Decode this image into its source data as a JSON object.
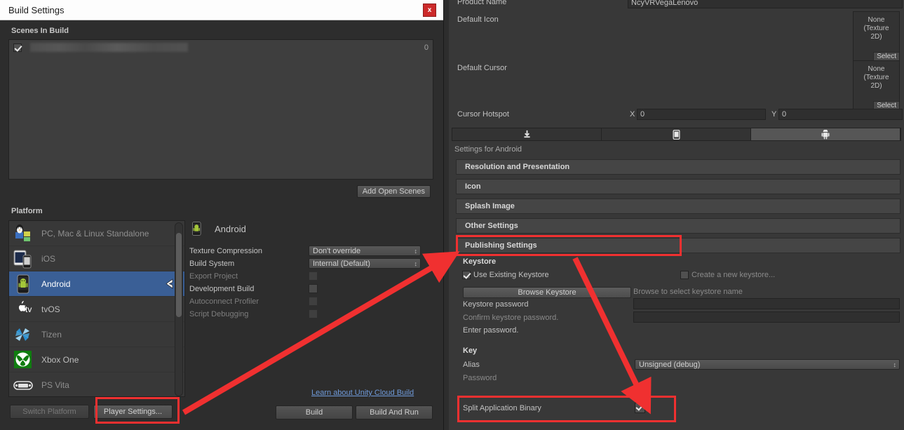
{
  "window": {
    "title": "Build Settings",
    "close_label": "x"
  },
  "scenes": {
    "header": "Scenes In Build",
    "rows": [
      {
        "checked": true,
        "name": "",
        "index": "0"
      }
    ],
    "add_open_scenes_label": "Add Open Scenes"
  },
  "platform": {
    "header": "Platform",
    "items": [
      {
        "label": "PC, Mac & Linux Standalone",
        "icon": "standalone-icon",
        "selected": false,
        "enabled": true
      },
      {
        "label": "iOS",
        "icon": "ios-icon",
        "selected": false,
        "enabled": false
      },
      {
        "label": "Android",
        "icon": "android-icon",
        "selected": true,
        "enabled": true
      },
      {
        "label": "tvOS",
        "icon": "tvos-icon",
        "selected": false,
        "enabled": true
      },
      {
        "label": "Tizen",
        "icon": "tizen-icon",
        "selected": false,
        "enabled": false
      },
      {
        "label": "Xbox One",
        "icon": "xbox-one-icon",
        "selected": false,
        "enabled": true
      },
      {
        "label": "PS Vita",
        "icon": "ps-vita-icon",
        "selected": false,
        "enabled": false
      }
    ],
    "switch_platform_label": "Switch Platform",
    "player_settings_label": "Player Settings..."
  },
  "build_options": {
    "platform_title": "Android",
    "texture_compression": {
      "label": "Texture Compression",
      "value": "Don't override"
    },
    "build_system": {
      "label": "Build System",
      "value": "Internal (Default)"
    },
    "toggles": [
      {
        "label": "Export Project",
        "checked": false,
        "enabled": false
      },
      {
        "label": "Development Build",
        "checked": false,
        "enabled": true
      },
      {
        "label": "Autoconnect Profiler",
        "checked": false,
        "enabled": false
      },
      {
        "label": "Script Debugging",
        "checked": false,
        "enabled": false
      }
    ],
    "cloud_build_link": "Learn about Unity Cloud Build",
    "build_label": "Build",
    "build_and_run_label": "Build And Run"
  },
  "inspector": {
    "product_name": {
      "label": "Product Name",
      "value": "NcyVRVegaLenovo"
    },
    "default_icon": {
      "label": "Default Icon",
      "value": "None\n(Texture 2D)",
      "select_label": "Select"
    },
    "default_cursor": {
      "label": "Default Cursor",
      "value": "None\n(Texture 2D)",
      "select_label": "Select"
    },
    "cursor_hotspot": {
      "label": "Cursor Hotspot",
      "x_label": "X",
      "x_value": "0",
      "y_label": "Y",
      "y_value": "0"
    },
    "tabs": [
      {
        "icon": "standalone-download-icon",
        "active": false
      },
      {
        "icon": "mobile-phone-icon",
        "active": false
      },
      {
        "icon": "android-robot-icon",
        "active": true
      }
    ],
    "settings_for": "Settings for Android",
    "foldouts": [
      {
        "label": "Resolution and Presentation",
        "highlighted": false
      },
      {
        "label": "Icon",
        "highlighted": false
      },
      {
        "label": "Splash Image",
        "highlighted": false
      },
      {
        "label": "Other Settings",
        "highlighted": false
      },
      {
        "label": "Publishing Settings",
        "highlighted": true
      }
    ],
    "keystore": {
      "group_title": "Keystore",
      "use_existing": {
        "label": "Use Existing Keystore",
        "checked": true
      },
      "create_new": {
        "label": "Create a new keystore...",
        "checked": false
      },
      "browse_button": "Browse Keystore",
      "browse_hint": "Browse to select keystore name",
      "password_label": "Keystore password",
      "password_value": "",
      "confirm_label": "Confirm keystore password.",
      "confirm_value": "",
      "enter_password_note": "Enter password."
    },
    "key": {
      "group_title": "Key",
      "alias_label": "Alias",
      "alias_value": "Unsigned (debug)",
      "password_label": "Password",
      "password_value": ""
    },
    "split_binary": {
      "label": "Split Application Binary",
      "checked": true
    }
  },
  "annotation": {
    "color": "#f03030"
  }
}
